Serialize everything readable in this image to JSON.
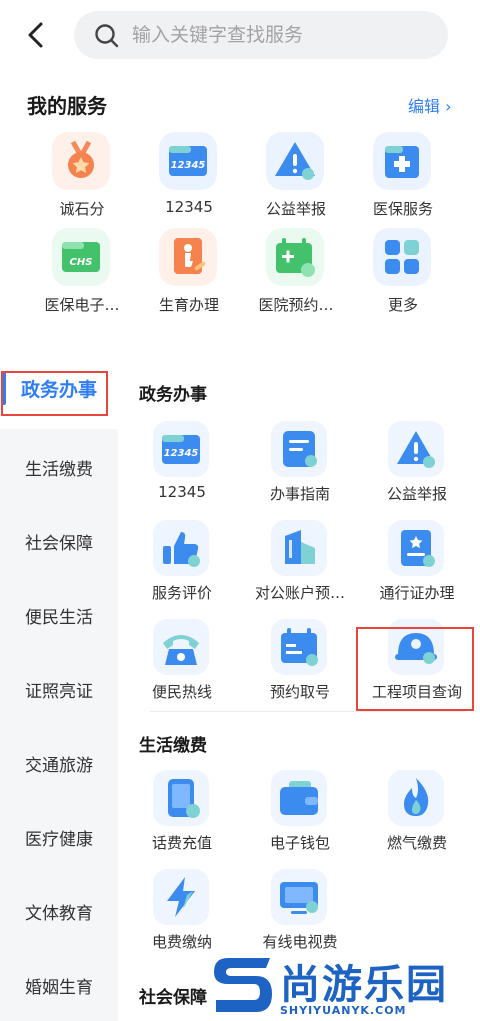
{
  "search": {
    "placeholder": "输入关键字查找服务"
  },
  "my_services": {
    "title": "我的服务",
    "edit_label": "编辑",
    "items": [
      {
        "label": "诚石分",
        "icon": "medal-icon"
      },
      {
        "label": "12345",
        "icon": "hotline-12345-icon"
      },
      {
        "label": "公益举报",
        "icon": "warning-icon"
      },
      {
        "label": "医保服务",
        "icon": "medical-insurance-icon"
      },
      {
        "label": "医保电子…",
        "icon": "chs-card-icon"
      },
      {
        "label": "生育办理",
        "icon": "maternity-icon"
      },
      {
        "label": "医院预约…",
        "icon": "hospital-appointment-icon"
      },
      {
        "label": "更多",
        "icon": "grid-icon"
      }
    ]
  },
  "sidebar": {
    "items": [
      {
        "label": "政务办事",
        "active": true
      },
      {
        "label": "生活缴费"
      },
      {
        "label": "社会保障"
      },
      {
        "label": "便民生活"
      },
      {
        "label": "证照亮证"
      },
      {
        "label": "交通旅游"
      },
      {
        "label": "医疗健康"
      },
      {
        "label": "文体教育"
      },
      {
        "label": "婚姻生育"
      }
    ]
  },
  "sections": {
    "gov": {
      "title": "政务办事",
      "items": [
        {
          "label": "12345",
          "icon": "hotline-12345-icon"
        },
        {
          "label": "办事指南",
          "icon": "guide-icon"
        },
        {
          "label": "公益举报",
          "icon": "warning-icon"
        },
        {
          "label": "服务评价",
          "icon": "thumbs-up-icon"
        },
        {
          "label": "对公账户预…",
          "icon": "building-icon"
        },
        {
          "label": "通行证办理",
          "icon": "pass-icon"
        },
        {
          "label": "便民热线",
          "icon": "telephone-icon"
        },
        {
          "label": "预约取号",
          "icon": "calendar-icon"
        },
        {
          "label": "工程项目查询",
          "icon": "helmet-icon"
        }
      ]
    },
    "life": {
      "title": "生活缴费",
      "items": [
        {
          "label": "话费充值",
          "icon": "phone-recharge-icon"
        },
        {
          "label": "电子钱包",
          "icon": "wallet-icon"
        },
        {
          "label": "燃气缴费",
          "icon": "flame-icon"
        },
        {
          "label": "电费缴纳",
          "icon": "lightning-icon"
        },
        {
          "label": "有线电视费",
          "icon": "tv-icon"
        }
      ]
    },
    "social": {
      "title": "社会保障"
    }
  },
  "watermark": {
    "cn": "尚游乐园",
    "en": "SHYIYUANYK.COM"
  },
  "colors": {
    "accent": "#2f7ef5",
    "highlight_box": "#e8463a"
  }
}
